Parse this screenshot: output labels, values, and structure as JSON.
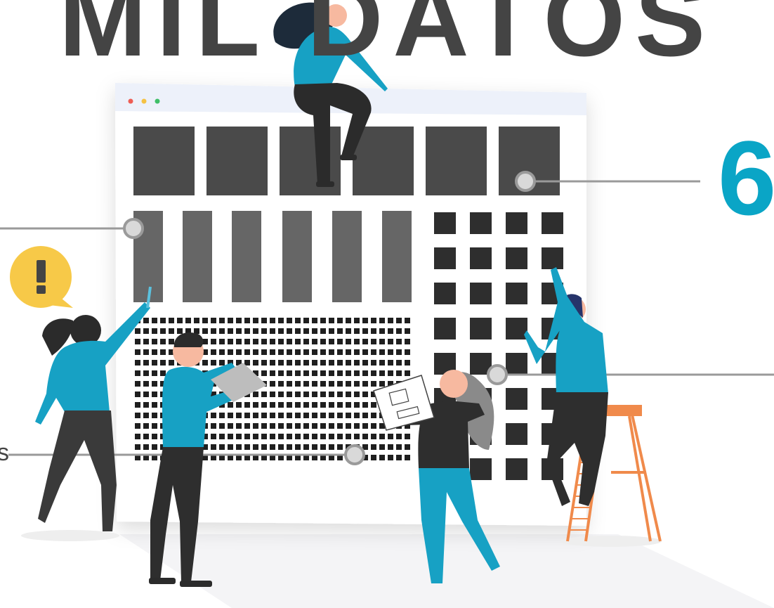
{
  "headline": "MIL DATOS",
  "stat": "6",
  "side_label": "s",
  "alert_icon": "exclamation-bubble-icon",
  "window_dots": [
    "#ee5d54",
    "#f5c243",
    "#3fbf68"
  ],
  "colors": {
    "accent": "#0aa5c6",
    "dark": "#444444",
    "alert": "#f7c948",
    "ladder": "#f08a4b"
  }
}
